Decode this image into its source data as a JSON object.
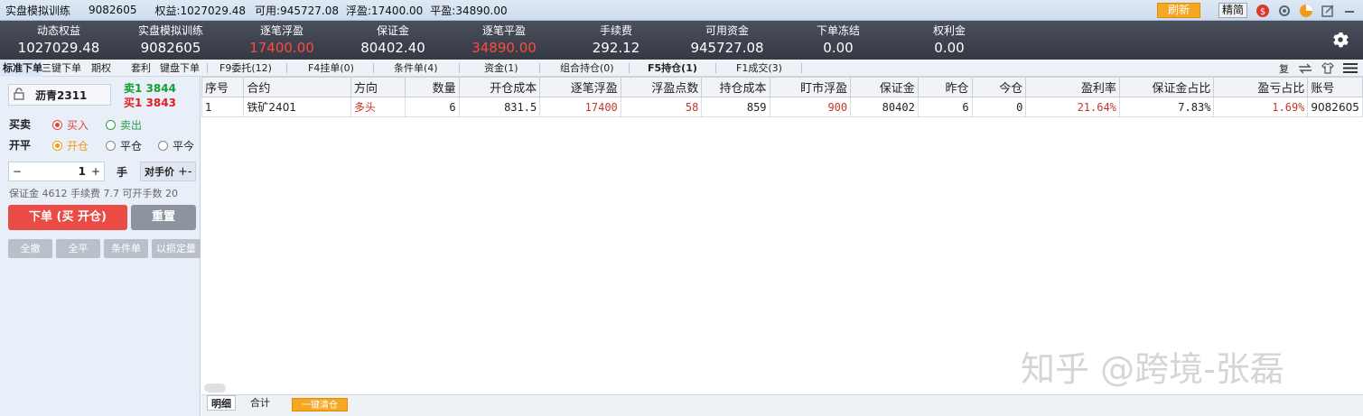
{
  "titlebar": {
    "mode": "实盘模拟训练",
    "account": "9082605",
    "equity": "权益:1027029.48",
    "available": "可用:945727.08",
    "float_pl": "浮盈:17400.00",
    "close_pl": "平盈:34890.00",
    "refresh_label": "刷新",
    "simple_label": "精简"
  },
  "stats": [
    {
      "label": "动态权益",
      "value": "1027029.48",
      "red": false
    },
    {
      "label": "实盘模拟训练",
      "value": "9082605",
      "red": false
    },
    {
      "label": "逐笔浮盈",
      "value": "17400.00",
      "red": true
    },
    {
      "label": "保证金",
      "value": "80402.40",
      "red": false
    },
    {
      "label": "逐笔平盈",
      "value": "34890.00",
      "red": true
    },
    {
      "label": "手续费",
      "value": "292.12",
      "red": false
    },
    {
      "label": "可用资金",
      "value": "945727.08",
      "red": false
    },
    {
      "label": "下单冻结",
      "value": "0.00",
      "red": false
    },
    {
      "label": "权利金",
      "value": "0.00",
      "red": false
    }
  ],
  "tabs_left": [
    "标准下单",
    "三键下单",
    "期权",
    "套利",
    "键盘下单"
  ],
  "tabs_main": [
    "F9委托(12)",
    "F4挂单(0)",
    "条件单(4)",
    "资金(1)",
    "组合持仓(0)",
    "F5持仓(1)",
    "F1成交(3)"
  ],
  "tab_right_fu": "复",
  "order_panel": {
    "contract": "沥青2311",
    "sell1": "卖1 3844",
    "buy1": "买1 3843",
    "side_label": "买卖",
    "buy_option": "买入",
    "sell_option": "卖出",
    "offset_label": "开平",
    "open_option": "开仓",
    "close_option": "平仓",
    "close_today_option": "平今",
    "qty_minus": "−",
    "qty": "1",
    "qty_plus": "+",
    "unit": "手",
    "price_type": "对手价",
    "price_pm": "+-",
    "info": "保证金 4612   手续费 7.7 可开手数 20",
    "order_button": "下单 (买 开仓)",
    "reset_button": "重置",
    "small_buttons": [
      "全撤",
      "全平",
      "条件单",
      "以损定量"
    ]
  },
  "positions": {
    "headers": [
      "序号",
      "合约",
      "方向",
      "数量",
      "开仓成本",
      "逐笔浮盈",
      "浮盈点数",
      "持仓成本",
      "盯市浮盈",
      "保证金",
      "昨仓",
      "今仓",
      "盈利率",
      "保证金占比",
      "盈亏占比",
      "账号"
    ],
    "rows": [
      [
        "1",
        "铁矿2401",
        "多头",
        "6",
        "831.5",
        "17400",
        "58",
        "859",
        "900",
        "80402",
        "6",
        "0",
        "21.64%",
        "7.83%",
        "1.69%",
        "9082605"
      ]
    ]
  },
  "watermark": "知乎 @跨境-张磊",
  "bottom": {
    "detail_tab": "明细",
    "total_tab": "合计",
    "clear_button": "一键清仓"
  },
  "colors": {
    "refresh": "#f5a623",
    "order_button": "#ea4b44",
    "stat_red": "#ff4a3d",
    "table_red": "#c0392b"
  }
}
